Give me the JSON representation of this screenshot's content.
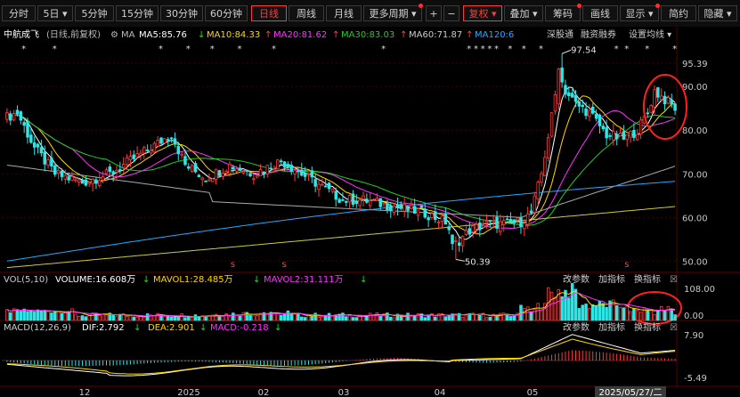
{
  "toolbar": {
    "items": [
      {
        "label": "分时",
        "x": 2,
        "w": 38
      },
      {
        "label": "5日 ▾",
        "x": 44,
        "w": 38
      },
      {
        "label": "5分钟",
        "x": 86,
        "w": 44
      },
      {
        "label": "15分钟",
        "x": 132,
        "w": 48
      },
      {
        "label": "30分钟",
        "x": 182,
        "w": 48
      },
      {
        "label": "60分钟",
        "x": 232,
        "w": 48
      },
      {
        "label": "日线",
        "x": 255,
        "w": 40,
        "active": true
      },
      {
        "label": "周线",
        "x": 298,
        "w": 40
      },
      {
        "label": "月线",
        "x": 340,
        "w": 40
      },
      {
        "label": "更多周期 ▾",
        "x": 382,
        "w": 68,
        "dot": true
      },
      {
        "label": "+",
        "x": 458,
        "w": 20
      },
      {
        "label": "−",
        "x": 480,
        "w": 20
      },
      {
        "label": "复权 ▾",
        "x": 504,
        "w": 42,
        "active": true
      },
      {
        "label": "叠加 ▾",
        "x": 548,
        "w": 42
      },
      {
        "label": "筹码",
        "x": 592,
        "w": 40,
        "dot": true
      },
      {
        "label": "画线",
        "x": 632,
        "w": 40
      },
      {
        "label": "显示 ▾",
        "x": 674,
        "w": 42,
        "dot": true
      },
      {
        "label": "简约",
        "x": 718,
        "w": 40
      },
      {
        "label": "隐藏 ▾",
        "x": 760,
        "w": 44
      },
      {
        "label": "⊠",
        "x": 806,
        "w": 20
      }
    ]
  },
  "colors": {
    "up": "#ff3b3b",
    "down": "#2ee6e6",
    "bg": "#000000",
    "grid": "#3a0000",
    "ma5": "#ffffff",
    "ma10": "#ffd700",
    "ma20": "#ff33ff",
    "ma30": "#22cc22",
    "ma60": "#aaaaaa",
    "ma120": "#22aaff",
    "ma250": "#cccc44"
  },
  "main": {
    "stock_name": "中航成飞",
    "mode": "(日线,前复权)",
    "ma_label": "MA",
    "ma_items": [
      {
        "text": "MA5:85.76",
        "arrow": "↓",
        "color": "#ffffff"
      },
      {
        "text": "MA10:84.33",
        "arrow": "↑",
        "color": "#ffd700"
      },
      {
        "text": "MA20:81.62",
        "arrow": "↑",
        "color": "#ff33ff"
      },
      {
        "text": "MA30:83.03",
        "arrow": "↑",
        "color": "#22cc22"
      },
      {
        "text": "MA60:71.87",
        "arrow": "↑",
        "color": "#cccccc"
      },
      {
        "text": "MA120:6",
        "arrow": "",
        "color": "#22aaff"
      }
    ],
    "btn_hkconnect": "深股通",
    "btn_margin": "融资融券",
    "btn_setma": "设置均线 ▾",
    "y_ticks": [
      "95.39",
      "90.00",
      "80.00",
      "70.00",
      "60.00",
      "50.00"
    ],
    "y_values": [
      95.39,
      90,
      80,
      70,
      60,
      50
    ],
    "ylim": [
      47,
      98
    ],
    "high_label": "97.54",
    "low_label": "50.39",
    "star": "*",
    "s_mark": "s"
  },
  "volume": {
    "label": "VOL(5,10)",
    "volume_text": "VOLUME:16.608万",
    "mavol1_text": "MAVOL1:28.485万",
    "mavol2_text": "MAVOL2:31.111万",
    "arrow": "↓",
    "btn_param": "改参数",
    "btn_add": "加指标",
    "btn_switch": "换指标",
    "y_ticks": [
      "108.00",
      "0.00"
    ]
  },
  "macd": {
    "label": "MACD(12,26,9)",
    "dif_text": "DIF:2.792",
    "dea_text": "DEA:2.901",
    "macd_text": "MACD:-0.218",
    "arrow": "↓",
    "btn_param": "改参数",
    "btn_add": "加指标",
    "btn_switch": "换指标",
    "y_ticks": [
      "7.90",
      "-5.49"
    ]
  },
  "x_axis": {
    "labels": [
      "12",
      "2025",
      "02",
      "03",
      "04",
      "05"
    ],
    "cursor_date": "2025/05/27/二"
  },
  "chart_data": {
    "type": "candlestick",
    "title": "中航成飞",
    "subtitle": "(日线,前复权)",
    "x_labels": [
      "12",
      "2025",
      "02",
      "03",
      "04",
      "05"
    ],
    "ylim": [
      47,
      98
    ],
    "price_ticks": [
      95.39,
      90,
      80,
      70,
      60,
      50
    ],
    "high": 97.54,
    "low": 50.39,
    "keypoints": [
      {
        "i": 0,
        "c": 83
      },
      {
        "i": 3,
        "c": 84
      },
      {
        "i": 8,
        "c": 76
      },
      {
        "i": 14,
        "c": 70
      },
      {
        "i": 22,
        "c": 68
      },
      {
        "i": 30,
        "c": 70
      },
      {
        "i": 38,
        "c": 74
      },
      {
        "i": 44,
        "c": 77
      },
      {
        "i": 48,
        "c": 79
      },
      {
        "i": 52,
        "c": 72
      },
      {
        "i": 58,
        "c": 69
      },
      {
        "i": 65,
        "c": 72
      },
      {
        "i": 72,
        "c": 70
      },
      {
        "i": 80,
        "c": 73
      },
      {
        "i": 86,
        "c": 70
      },
      {
        "i": 92,
        "c": 67
      },
      {
        "i": 98,
        "c": 64
      },
      {
        "i": 104,
        "c": 64
      },
      {
        "i": 110,
        "c": 63
      },
      {
        "i": 116,
        "c": 62
      },
      {
        "i": 122,
        "c": 61
      },
      {
        "i": 128,
        "c": 59
      },
      {
        "i": 131,
        "c": 54
      },
      {
        "i": 135,
        "c": 57
      },
      {
        "i": 140,
        "c": 58.5
      },
      {
        "i": 146,
        "c": 58.5
      },
      {
        "i": 150,
        "c": 59
      },
      {
        "i": 153,
        "c": 61
      },
      {
        "i": 156,
        "c": 70
      },
      {
        "i": 159,
        "c": 83
      },
      {
        "i": 161,
        "c": 93
      },
      {
        "i": 163,
        "c": 89
      },
      {
        "i": 166,
        "c": 86
      },
      {
        "i": 170,
        "c": 84
      },
      {
        "i": 175,
        "c": 79
      },
      {
        "i": 180,
        "c": 78
      },
      {
        "i": 184,
        "c": 80
      },
      {
        "i": 187,
        "c": 84
      },
      {
        "i": 189,
        "c": 89
      },
      {
        "i": 192,
        "c": 87
      },
      {
        "i": 195,
        "c": 85
      }
    ],
    "volume_ylim": [
      0,
      108
    ],
    "volume_current": 16.608,
    "mavol1": 28.485,
    "mavol2": 31.111,
    "macd": {
      "dif": 2.792,
      "dea": 2.901,
      "macd": -0.218,
      "ylim": [
        -5.49,
        7.9
      ]
    },
    "ma": {
      "ma5": 85.76,
      "ma10": 84.33,
      "ma20": 81.62,
      "ma30": 83.03,
      "ma60": 71.87
    }
  }
}
